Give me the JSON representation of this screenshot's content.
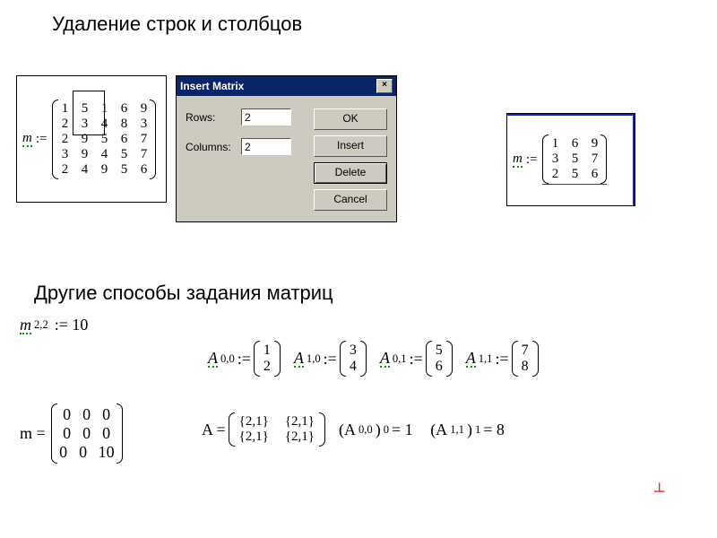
{
  "heading1": "Удаление строк и столбцов",
  "heading2": "Другие способы задания матриц",
  "leftMatrix": {
    "var": "m",
    "assign": ":=",
    "rows": [
      [
        "1",
        "5",
        "1",
        "6",
        "9"
      ],
      [
        "2",
        "3",
        "4",
        "8",
        "3"
      ],
      [
        "2",
        "9",
        "5",
        "6",
        "7"
      ],
      [
        "3",
        "9",
        "4",
        "5",
        "7"
      ],
      [
        "2",
        "4",
        "9",
        "5",
        "6"
      ]
    ]
  },
  "rightMatrix": {
    "var": "m",
    "assign": ":=",
    "rows": [
      [
        "1",
        "6",
        "9"
      ],
      [
        "3",
        "5",
        "7"
      ],
      [
        "2",
        "5",
        "6"
      ]
    ]
  },
  "dialog": {
    "title": "Insert Matrix",
    "close": "×",
    "rowsLabel": "Rows:",
    "rowsValue": "2",
    "colsLabel": "Columns:",
    "colsValue": "2",
    "btnOK": "OK",
    "btnInsert": "Insert",
    "btnDelete": "Delete",
    "btnCancel": "Cancel"
  },
  "assign22": {
    "var": "m",
    "sub": "2,2",
    "expr": ":= 10"
  },
  "mResult": {
    "label": "m =",
    "rows": [
      [
        "0",
        "0",
        "0"
      ],
      [
        "0",
        "0",
        "0"
      ],
      [
        "0",
        "0",
        "10"
      ]
    ]
  },
  "Adefs": [
    {
      "var": "A",
      "sub": "0,0",
      "col": [
        "1",
        "2"
      ]
    },
    {
      "var": "A",
      "sub": "1,0",
      "col": [
        "3",
        "4"
      ]
    },
    {
      "var": "A",
      "sub": "0,1",
      "col": [
        "5",
        "6"
      ]
    },
    {
      "var": "A",
      "sub": "1,1",
      "col": [
        "7",
        "8"
      ]
    }
  ],
  "AmatrixLabel": "A =",
  "Amatrix": {
    "rows": [
      [
        "{2,1}",
        "{2,1}"
      ],
      [
        "{2,1}",
        "{2,1}"
      ]
    ]
  },
  "Aelem1": {
    "left": "(A",
    "sub1": "0,0",
    "mid": ")",
    "sub2": "0",
    "eq": "= 1"
  },
  "Aelem2": {
    "left": "(A",
    "sub1": "1,1",
    "mid": ")",
    "sub2": "1",
    "eq": "= 8"
  },
  "cursor": "┴"
}
